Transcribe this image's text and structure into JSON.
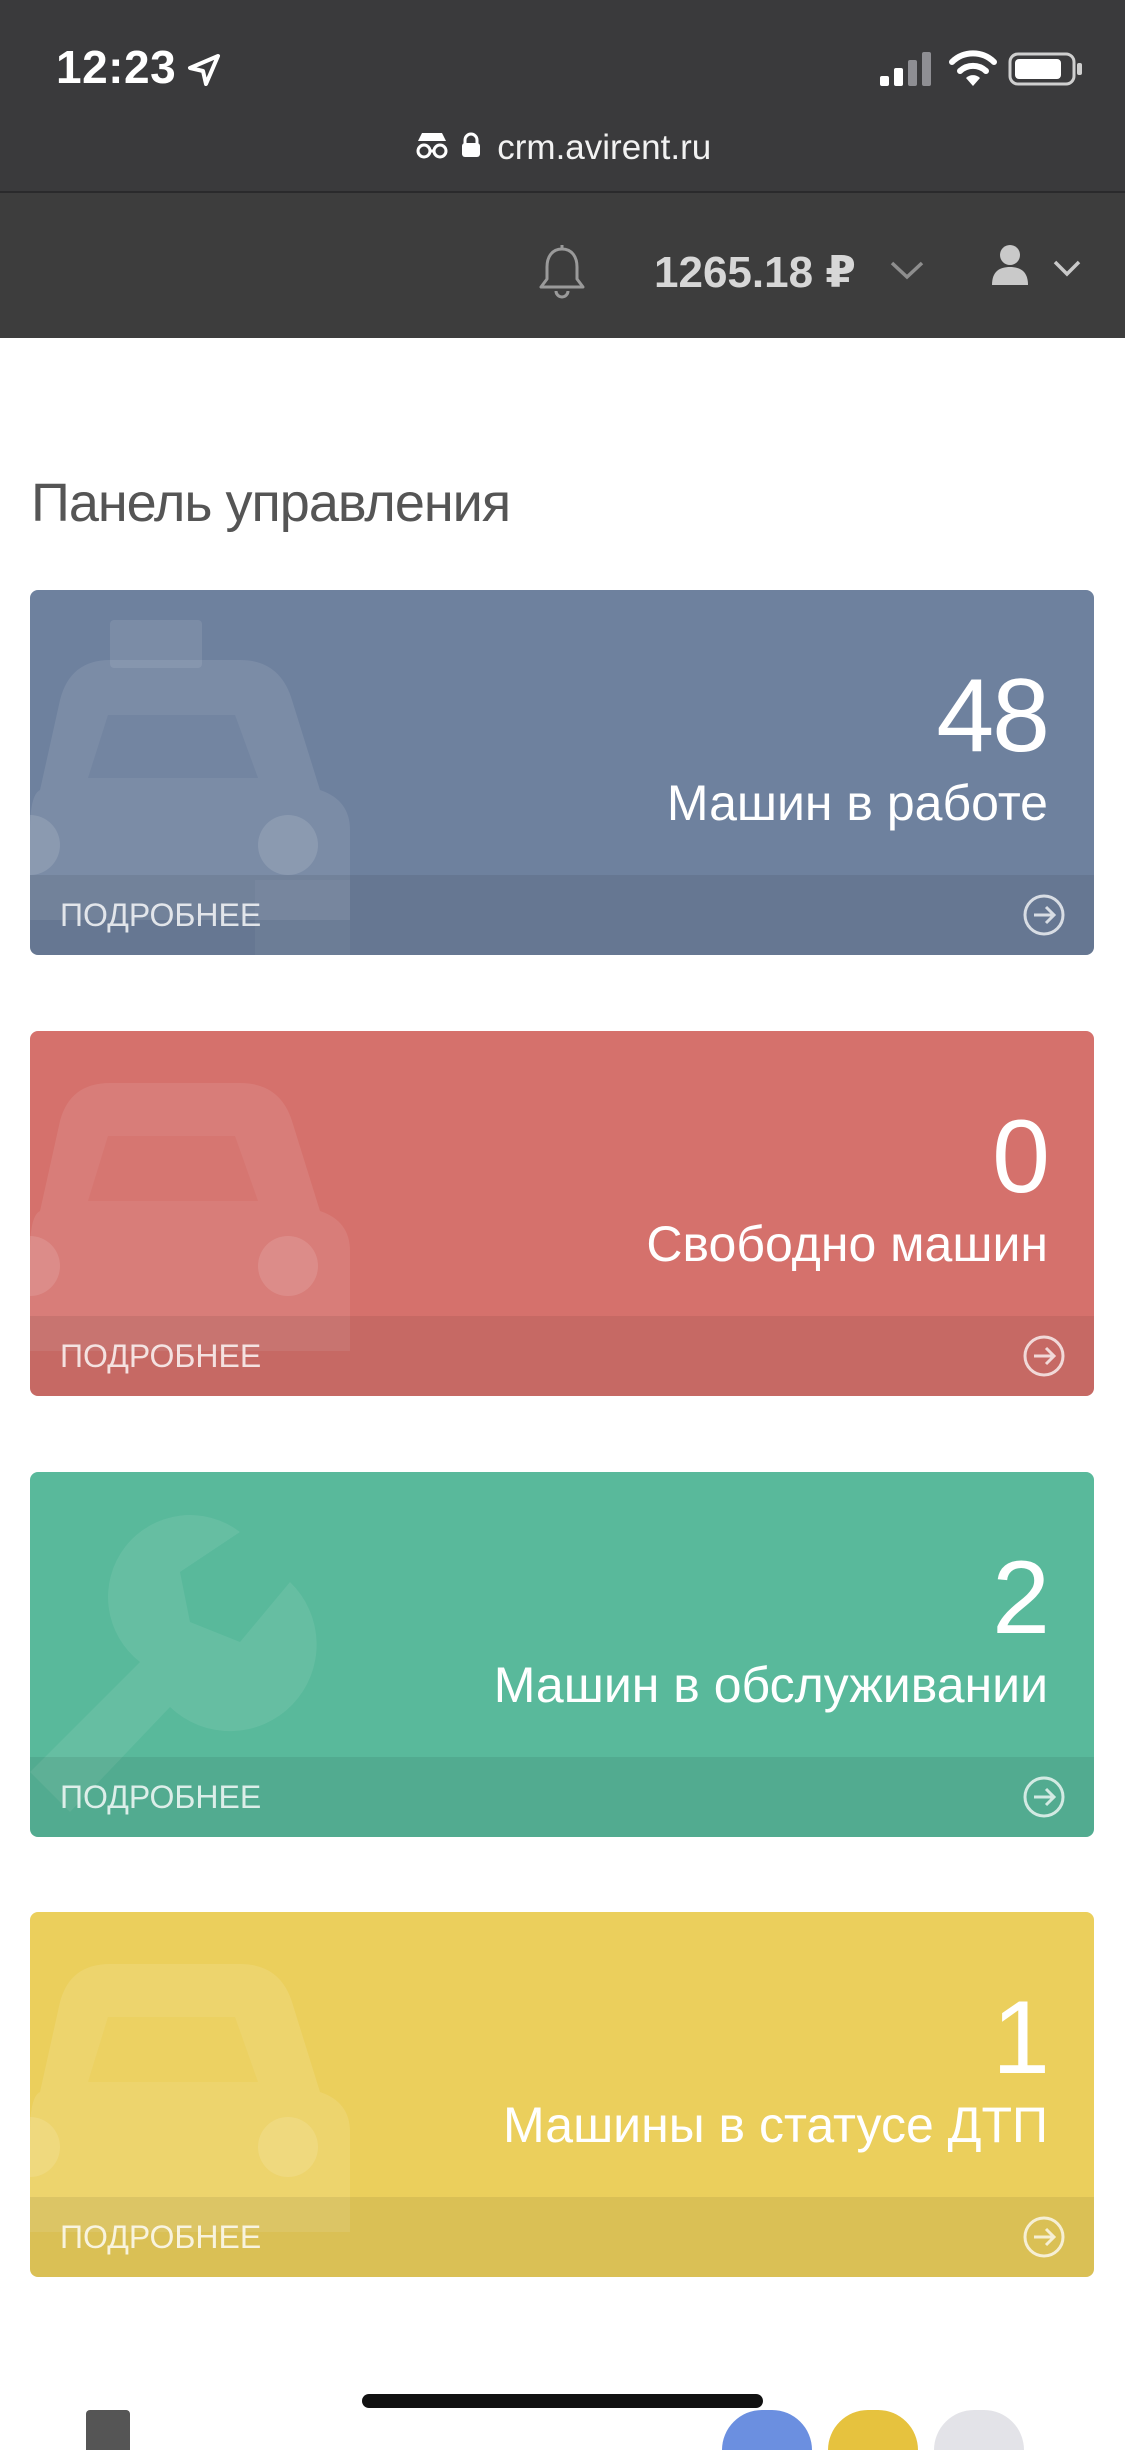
{
  "status_bar": {
    "time": "12:23",
    "url": "crm.avirent.ru"
  },
  "header": {
    "balance": "1265.18 ₽"
  },
  "page": {
    "title": "Панель управления"
  },
  "cards": [
    {
      "number": "48",
      "label": "Машин в работе",
      "more": "ПОДРОБНЕЕ",
      "color": "#6e819e",
      "icon": "taxi-icon"
    },
    {
      "number": "0",
      "label": "Свободно машин",
      "more": "ПОДРОБНЕЕ",
      "color": "#d5716c",
      "icon": "car-icon"
    },
    {
      "number": "2",
      "label": "Машин в обслуживании",
      "more": "ПОДРОБНЕЕ",
      "color": "#59b99b",
      "icon": "wrench-icon"
    },
    {
      "number": "1",
      "label": "Машины в статусе ДТП",
      "more": "ПОДРОБНЕЕ",
      "color": "#ebcf5c",
      "icon": "car-icon"
    }
  ]
}
